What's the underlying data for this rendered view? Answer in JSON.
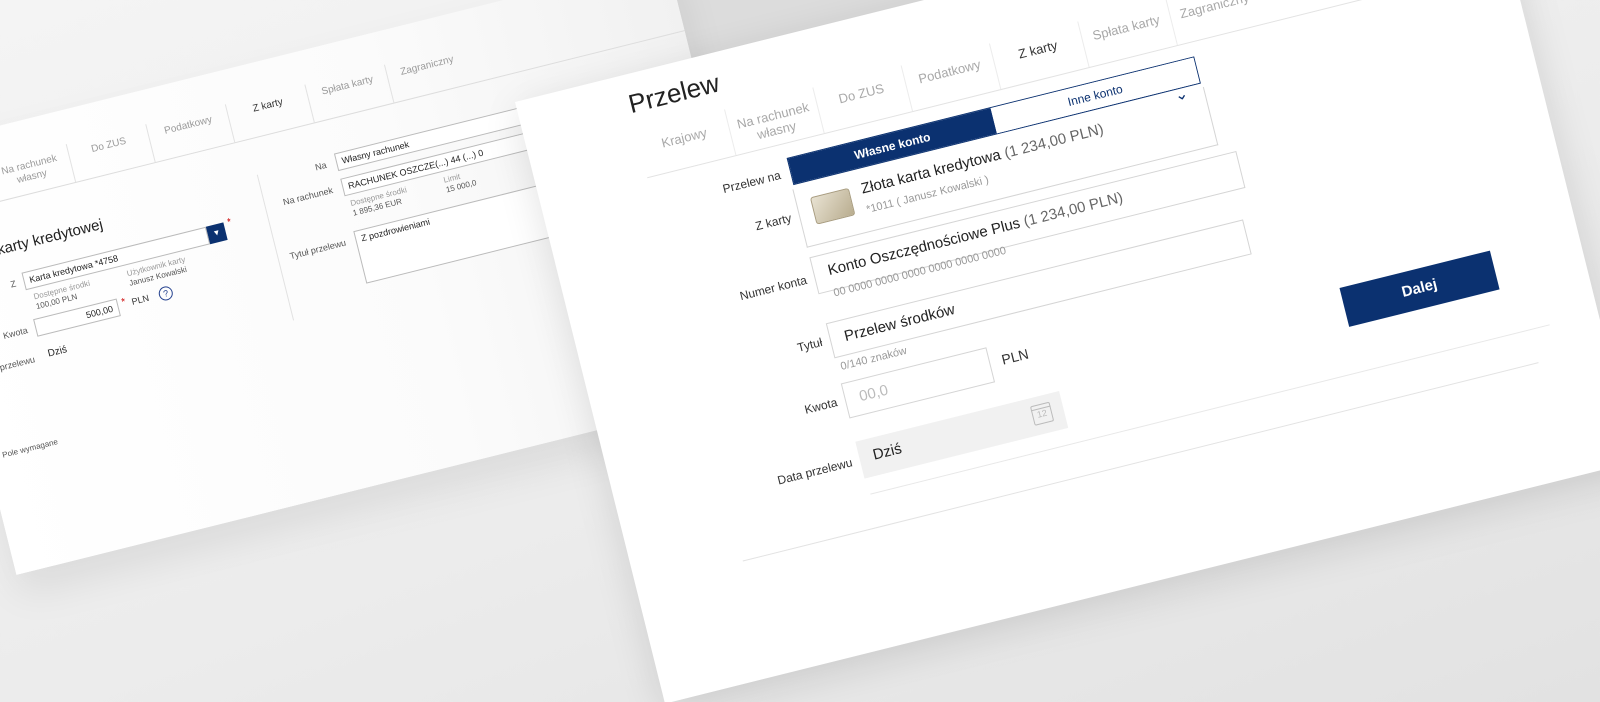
{
  "old_form": {
    "tabs": [
      "Na rachunek własny",
      "Do ZUS",
      "Podatkowy",
      "Z karty",
      "Spłata karty",
      "Zagraniczny"
    ],
    "active_tab": "Z karty",
    "heading": "karty kredytowej",
    "labels": {
      "z": "Z",
      "kwota": "Kwota",
      "data": "Data przelewu",
      "na": "Na",
      "na_rachunek": "Na rachunek",
      "tytul": "Tytuł przelewu"
    },
    "card_select": "Karta kredytowa *4758",
    "available_label": "Dostępne środki",
    "available_value": "100,00 PLN",
    "card_user_label": "Użytkownik karty",
    "card_user_value": "Janusz Kowalski",
    "amount": "500,00",
    "currency": "PLN",
    "help": "?",
    "date": "Dziś",
    "na_select": "Własny rachunek",
    "account_select": "RACHUNEK OSZCZE(...) 44 (...) 0",
    "acc_available_label": "Dostępne środki",
    "acc_available_value": "1 895,36 EUR",
    "limit_label": "Limit",
    "limit_value": "15 000,0",
    "title_value": "Z pozdrowieniami",
    "required_star": "*",
    "required_note": "Pole wymagane"
  },
  "main_form": {
    "title": "Przelew",
    "tabs": [
      "Krajowy",
      "Na rachunek własny",
      "Do ZUS",
      "Podatkowy",
      "Z karty",
      "Spłata karty",
      "Zagraniczny"
    ],
    "active_tab": "Z karty",
    "labels": {
      "przelew_na": "Przelew na",
      "z_karty": "Z karty",
      "numer_konta": "Numer konta",
      "tytul": "Tytuł",
      "kwota": "Kwota",
      "data": "Data przelewu"
    },
    "toggle": {
      "own": "Własne konto",
      "other": "Inne konto"
    },
    "card": {
      "name": "Złota karta kredytowa",
      "balance": "(1 234,00 PLN)",
      "number": "*1011 ( Janusz Kowalski )"
    },
    "account": {
      "name": "Konto Oszczędnościowe Plus",
      "balance": "(1 234,00 PLN)",
      "number": "00 0000 0000 0000 0000 0000 0000"
    },
    "title_value": "Przelew środków",
    "char_count": "0/140 znaków",
    "amount_placeholder": "00,0",
    "currency": "PLN",
    "date_value": "Dziś",
    "calendar_day": "12",
    "next_button": "Dalej"
  },
  "colors": {
    "brand": "#0b3170",
    "required": "#cc0000"
  }
}
